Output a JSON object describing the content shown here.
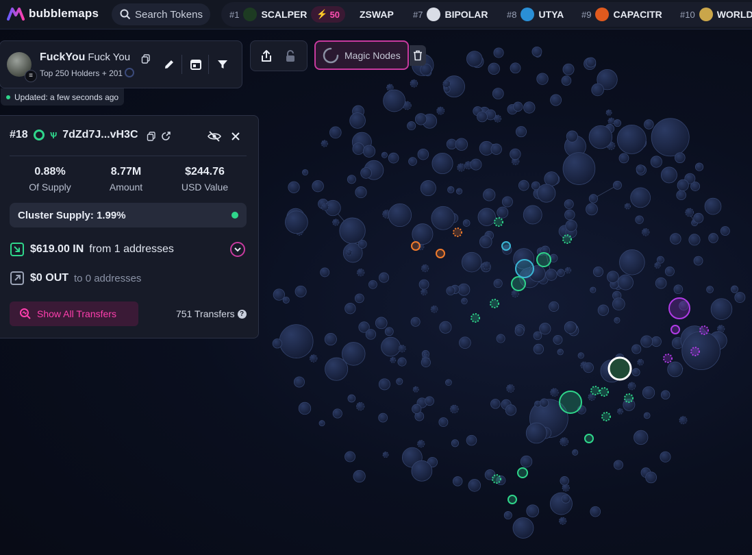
{
  "app": {
    "name": "bubblemaps"
  },
  "search": {
    "placeholder": "Search Tokens"
  },
  "ticker": [
    {
      "rank": "#1",
      "name": "SCALPER",
      "boost": "50",
      "avatar_color": "#1d3b22"
    },
    {
      "rank": "",
      "name": "ZSWAP",
      "avatar_color": ""
    },
    {
      "rank": "#7",
      "name": "BIPOLAR",
      "avatar_color": "#d9dde6"
    },
    {
      "rank": "#8",
      "name": "UTYA",
      "avatar_color": "#2a8fd6"
    },
    {
      "rank": "#9",
      "name": "CAPACITR",
      "avatar_color": "#e05a1e"
    },
    {
      "rank": "#10",
      "name": "WORLD",
      "avatar_color": "#caa64a"
    }
  ],
  "token": {
    "name": "FuckYou",
    "full_name": "Fuck You",
    "meta": "Top 250 Holders + 201",
    "updated": "Updated: a few seconds ago"
  },
  "magic_nodes": {
    "label": "Magic Nodes"
  },
  "wallet": {
    "rank": "#18",
    "address": "7dZd7J...vH3C",
    "stats": [
      {
        "value": "0.88%",
        "label": "Of Supply"
      },
      {
        "value": "8.77M",
        "label": "Amount"
      },
      {
        "value": "$244.76",
        "label": "USD Value"
      }
    ],
    "cluster_supply": "Cluster Supply: 1.99%",
    "in": {
      "amount": "$619.00 IN",
      "text": "from 1 addresses"
    },
    "out": {
      "amount": "$0 OUT",
      "text": "to 0 addresses"
    },
    "show_transfers": "Show All Transfers",
    "transfers_count": "751 Transfers"
  },
  "colors": {
    "accent": "#c83a9f",
    "green": "#2fd68b",
    "cyan": "#3bb6d6",
    "orange": "#f07b2c",
    "purple": "#b13be6",
    "bubble": "#1b2644"
  },
  "graph": {
    "highlighted_nodes": [
      {
        "cluster": "green",
        "size": "large"
      },
      {
        "cluster": "cyan",
        "size": "medium"
      },
      {
        "cluster": "orange",
        "size": "small"
      },
      {
        "cluster": "purple",
        "size": "medium"
      }
    ]
  }
}
